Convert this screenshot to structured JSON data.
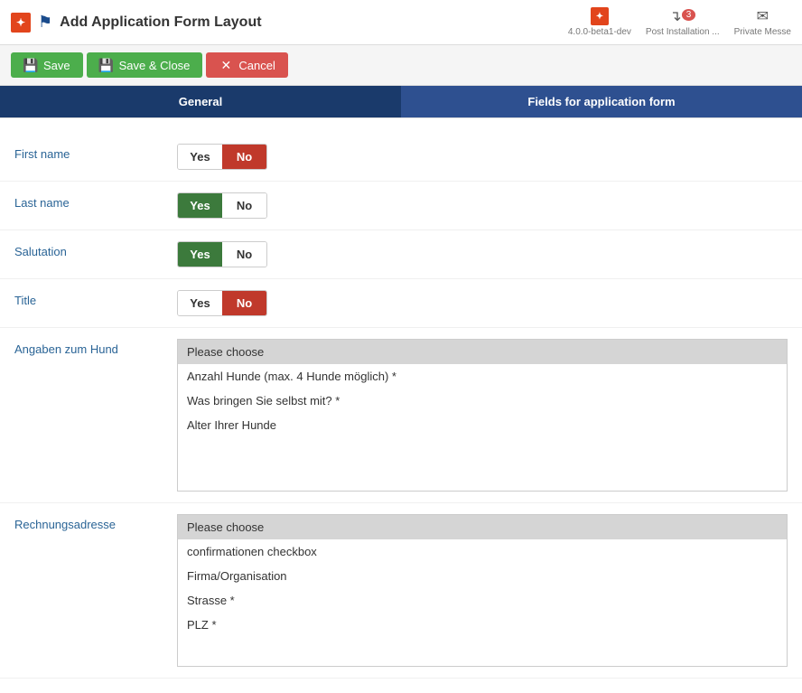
{
  "header": {
    "title": "Add Application Form Layout",
    "version": "4.0.0-beta1-dev",
    "post_installation_label": "Post Installation ...",
    "private_messages_label": "Private Messe",
    "notification_count": "3"
  },
  "toolbar": {
    "save_label": "Save",
    "save_close_label": "Save & Close",
    "cancel_label": "Cancel"
  },
  "tabs": [
    {
      "id": "general",
      "label": "General",
      "active": true
    },
    {
      "id": "fields",
      "label": "Fields for application form",
      "active": false
    }
  ],
  "fields": [
    {
      "id": "first-name",
      "label": "First name",
      "type": "yesno",
      "yes_active": false,
      "no_active": true
    },
    {
      "id": "last-name",
      "label": "Last name",
      "type": "yesno",
      "yes_active": true,
      "no_active": false
    },
    {
      "id": "salutation",
      "label": "Salutation",
      "type": "yesno",
      "yes_active": true,
      "no_active": false
    },
    {
      "id": "title",
      "label": "Title",
      "type": "yesno",
      "yes_active": false,
      "no_active": true
    },
    {
      "id": "angaben-zum-hund",
      "label": "Angaben zum Hund",
      "type": "listbox",
      "placeholder": "Please choose",
      "items": [
        "Anzahl Hunde (max. 4 Hunde möglich) *",
        "Was bringen Sie selbst mit? *",
        "Alter Ihrer Hunde"
      ]
    },
    {
      "id": "rechnungsadresse",
      "label": "Rechnungsadresse",
      "type": "listbox",
      "placeholder": "Please choose",
      "items": [
        "confirmationen checkbox",
        "Firma/Organisation",
        "Strasse *",
        "PLZ *"
      ]
    }
  ],
  "labels": {
    "yes": "Yes",
    "no": "No"
  }
}
